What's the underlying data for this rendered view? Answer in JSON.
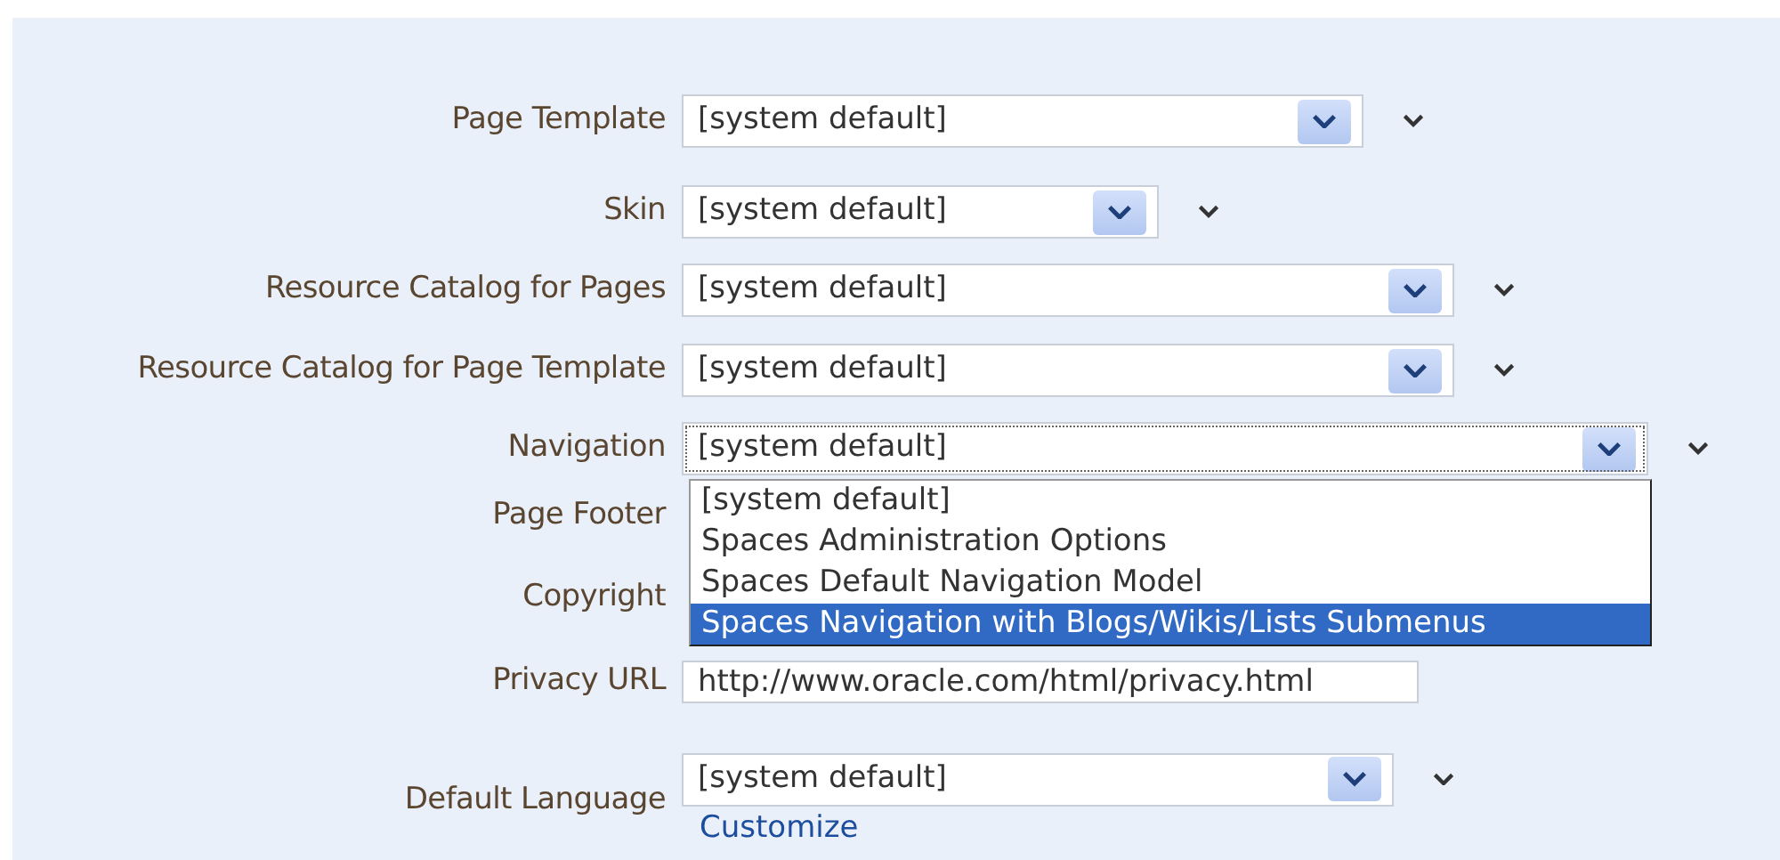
{
  "form": {
    "rows": [
      {
        "label": "Page Template",
        "kind": "select",
        "value": "[system default]",
        "expanded": false
      },
      {
        "label": "Skin",
        "kind": "select",
        "value": "[system default]",
        "expanded": false
      },
      {
        "label": "Resource Catalog for Pages",
        "kind": "select",
        "value": "[system default]",
        "expanded": false
      },
      {
        "label": "Resource Catalog for Page Template",
        "kind": "select",
        "value": "[system default]",
        "expanded": false
      },
      {
        "label": "Navigation",
        "kind": "select",
        "value": "[system default]",
        "expanded": true,
        "options": [
          {
            "text": "[system default]",
            "highlighted": false
          },
          {
            "text": "Spaces Administration Options",
            "highlighted": false
          },
          {
            "text": "Spaces Default Navigation Model",
            "highlighted": false
          },
          {
            "text": "Spaces Navigation with Blogs/Wikis/Lists Submenus",
            "highlighted": true
          }
        ]
      },
      {
        "label": "Page Footer",
        "kind": "covered"
      },
      {
        "label": "Copyright",
        "kind": "covered"
      },
      {
        "label": "Privacy URL",
        "kind": "text",
        "value": "http://www.oracle.com/html/privacy.html"
      },
      {
        "label": "Default Language",
        "kind": "select",
        "value": "[system default]",
        "expanded": false,
        "link": "Customize"
      }
    ]
  }
}
